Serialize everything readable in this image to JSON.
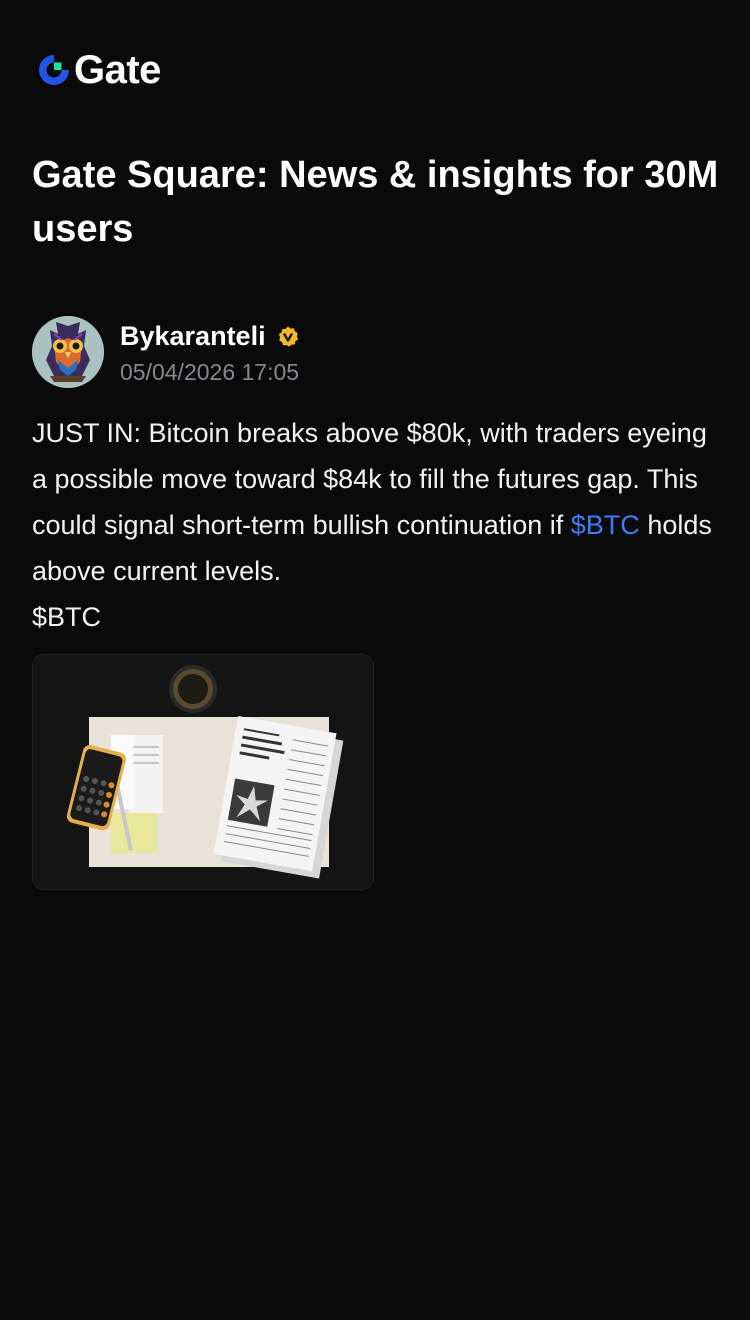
{
  "brand": {
    "name": "Gate",
    "logo_icon": "gate-logo-icon",
    "primary_color": "#2354e6",
    "accent_color": "#17e6a1"
  },
  "headline": "Gate Square: News & insights for 30M users",
  "post": {
    "author": {
      "name": "Bykaranteli",
      "verified": true,
      "verified_icon": "verified-badge-icon",
      "avatar_icon": "owl-avatar"
    },
    "timestamp": "05/04/2026 17:05",
    "body_before_tag": "JUST IN: Bitcoin breaks above $80k, with traders eyeing a possible move toward $84k to fill the futures gap. This could signal short-term bullish continuation if ",
    "tag": "$BTC",
    "body_after_tag": " holds above current levels.",
    "trailing_tag": "$BTC",
    "tag_color": "#3f7cf5",
    "image": {
      "icon": "tax-documents-photo"
    }
  }
}
